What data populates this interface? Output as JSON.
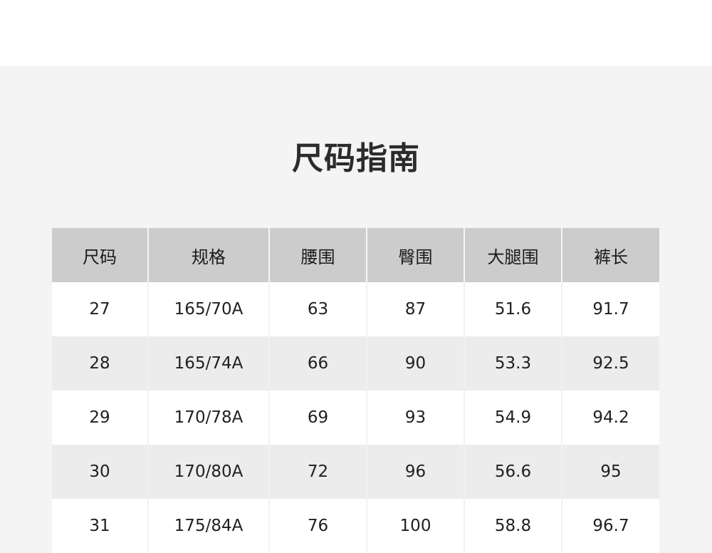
{
  "title": "尺码指南",
  "table": {
    "headers": [
      "尺码",
      "规格",
      "腰围",
      "臀围",
      "大腿围",
      "裤长"
    ],
    "rows": [
      [
        "27",
        "165/70A",
        "63",
        "87",
        "51.6",
        "91.7"
      ],
      [
        "28",
        "165/74A",
        "66",
        "90",
        "53.3",
        "92.5"
      ],
      [
        "29",
        "170/78A",
        "69",
        "93",
        "54.9",
        "94.2"
      ],
      [
        "30",
        "170/80A",
        "72",
        "96",
        "56.6",
        "95"
      ],
      [
        "31",
        "175/84A",
        "76",
        "100",
        "58.8",
        "96.7"
      ]
    ]
  },
  "colors": {
    "header_bg": "#cccccc",
    "page_bg": "#f4f4f4",
    "row_odd": "#ffffff",
    "row_even": "#ececec",
    "text": "#1f1f1f"
  }
}
